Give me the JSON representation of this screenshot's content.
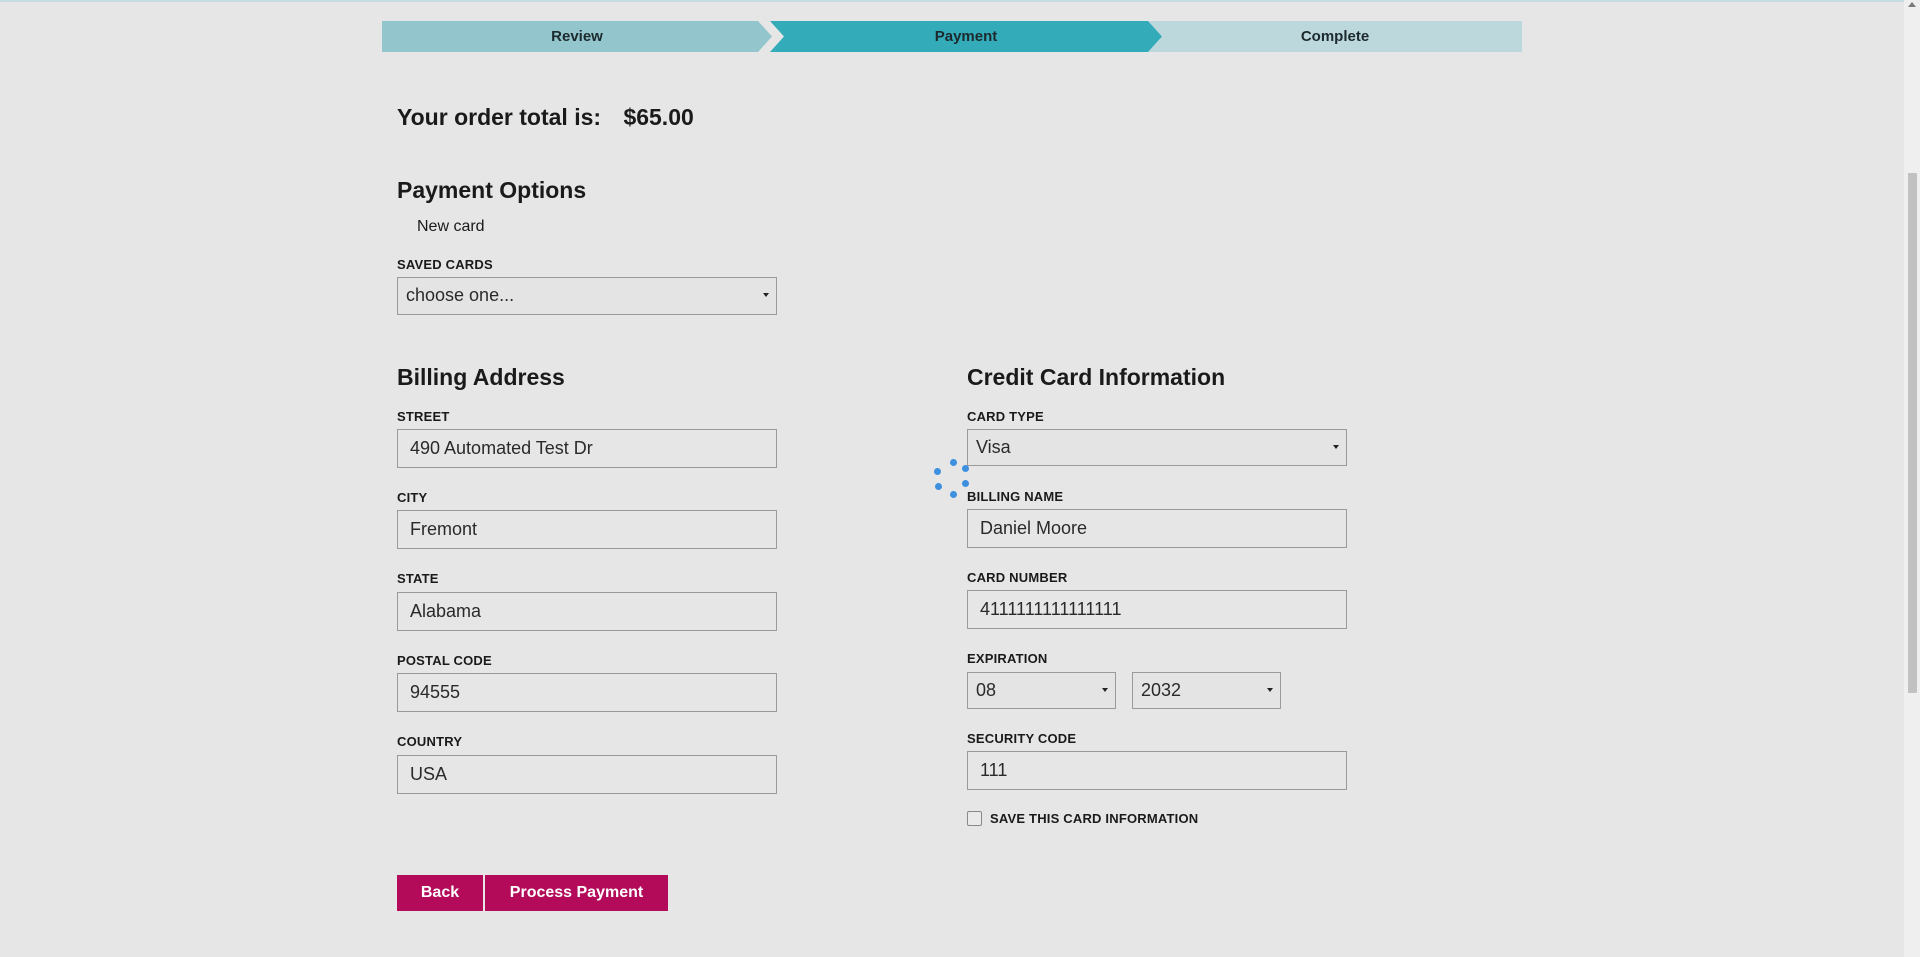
{
  "steps": [
    "Review",
    "Payment",
    "Complete"
  ],
  "order": {
    "label": "Your order total is:",
    "amount": "$65.00"
  },
  "payment_options": {
    "title": "Payment Options",
    "new_card": "New card",
    "saved_cards_label": "SAVED CARDS",
    "saved_cards_value": "choose one..."
  },
  "billing": {
    "title": "Billing Address",
    "street_label": "STREET",
    "street": "490 Automated Test Dr",
    "city_label": "CITY",
    "city": "Fremont",
    "state_label": "STATE",
    "state": "Alabama",
    "postal_label": "POSTAL CODE",
    "postal": "94555",
    "country_label": "COUNTRY",
    "country": "USA"
  },
  "card": {
    "title": "Credit Card Information",
    "type_label": "CARD TYPE",
    "type": "Visa",
    "name_label": "BILLING NAME",
    "name": "Daniel Moore",
    "number_label": "CARD NUMBER",
    "number": "4111111111111111",
    "expiration_label": "EXPIRATION",
    "exp_month": "08",
    "exp_year": "2032",
    "security_label": "SECURITY CODE",
    "security": "111",
    "save_label": "SAVE THIS CARD INFORMATION"
  },
  "buttons": {
    "back": "Back",
    "process": "Process Payment"
  },
  "colors": {
    "step_review": "#93c5cd",
    "step_payment": "#34abb9",
    "step_complete": "#bcd8dd",
    "button": "#b30b5a",
    "spinner": "#3d8fe0"
  },
  "icons": {
    "spinner": "loading-spinner-icon",
    "caret": "chevron-down-icon"
  }
}
